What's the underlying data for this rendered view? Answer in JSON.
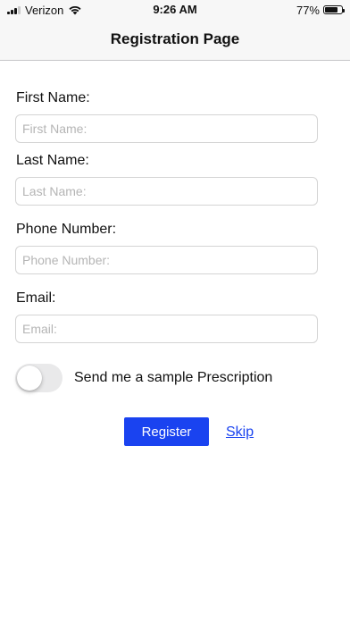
{
  "status_bar": {
    "carrier": "Verizon",
    "time": "9:26 AM",
    "battery_percent": "77%",
    "battery_level": 0.77,
    "icons": [
      "signal-icon",
      "wifi-icon",
      "battery-icon"
    ]
  },
  "nav": {
    "title": "Registration Page"
  },
  "form": {
    "first_name": {
      "label": "First Name:",
      "placeholder": "First Name:",
      "value": ""
    },
    "last_name": {
      "label": "Last Name:",
      "placeholder": "Last Name:",
      "value": ""
    },
    "phone": {
      "label": "Phone Number:",
      "placeholder": "Phone Number:",
      "value": ""
    },
    "email": {
      "label": "Email:",
      "placeholder": "Email:",
      "value": ""
    }
  },
  "sample_toggle": {
    "label": "Send me a sample Prescription",
    "on": false
  },
  "actions": {
    "register_label": "Register",
    "skip_label": "Skip"
  },
  "colors": {
    "accent": "#1a43f0",
    "bar_background": "#f7f7f7",
    "toggle_off": "#e9e9ea"
  }
}
